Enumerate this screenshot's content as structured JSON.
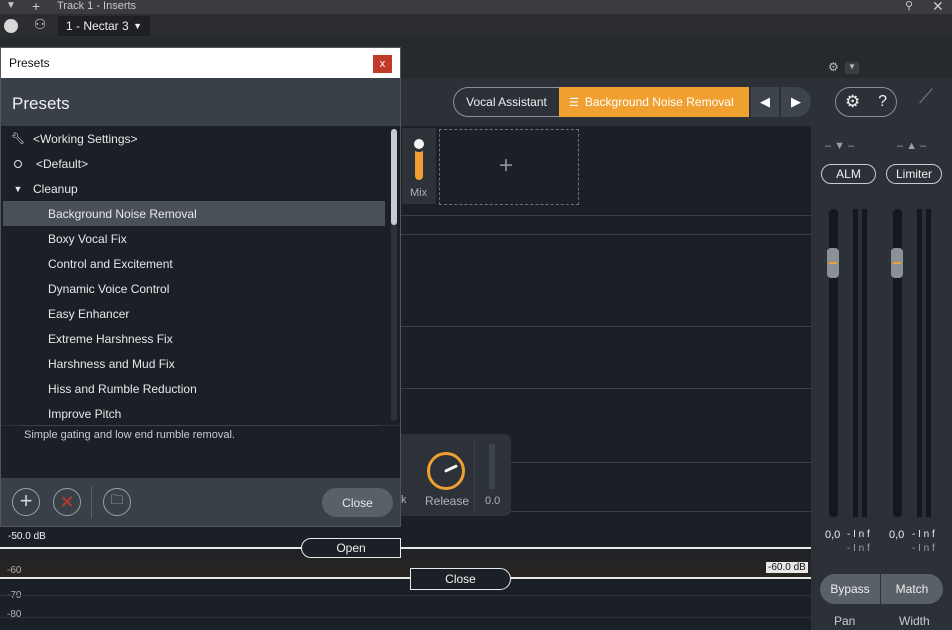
{
  "window": {
    "title": "Track 1 - Inserts",
    "plugin_selector": "1 - Nectar 3"
  },
  "dialog": {
    "title": "Presets",
    "close_x": "x",
    "heading": "Presets",
    "items": [
      {
        "label": "<Working Settings>",
        "icon": "wrench-icon"
      },
      {
        "label": "<Default>",
        "icon": "circle-icon"
      },
      {
        "label": "Cleanup",
        "icon": "triangle-down-icon"
      },
      {
        "label": "Background Noise Removal",
        "selected": true
      },
      {
        "label": "Boxy Vocal Fix"
      },
      {
        "label": "Control and Excitement"
      },
      {
        "label": "Dynamic Voice Control"
      },
      {
        "label": "Easy Enhancer"
      },
      {
        "label": "Extreme Harshness Fix"
      },
      {
        "label": "Harshness and Mud Fix"
      },
      {
        "label": "Hiss and Rumble Reduction"
      },
      {
        "label": "Improve Pitch"
      }
    ],
    "description": "Simple gating and low end rumble removal.",
    "close_label": "Close"
  },
  "toolbar": {
    "vocal_assistant": "Vocal Assistant",
    "preset_name": "Background Noise Removal",
    "help": "?",
    "accent": "#f0a030"
  },
  "mix": {
    "label": "Mix"
  },
  "gate": {
    "release_label": "Release",
    "value": "0.0",
    "partial_label": "k"
  },
  "graph": {
    "threshold_left": "-50.0 dB",
    "threshold_right": "-60.0 dB",
    "open_label": "Open",
    "close_label": "Close",
    "ticks": [
      "-60",
      "-70",
      "-80"
    ]
  },
  "right_panel": {
    "alm": "ALM",
    "limiter": "Limiter",
    "alm_value": "0,0",
    "alm_inf1": "- I n f",
    "alm_inf2": "- I n f",
    "lim_value": "0,0",
    "lim_inf1": "- I n f",
    "lim_inf2": "- I n f",
    "bypass": "Bypass",
    "match": "Match",
    "pan": "Pan",
    "width": "Width"
  }
}
